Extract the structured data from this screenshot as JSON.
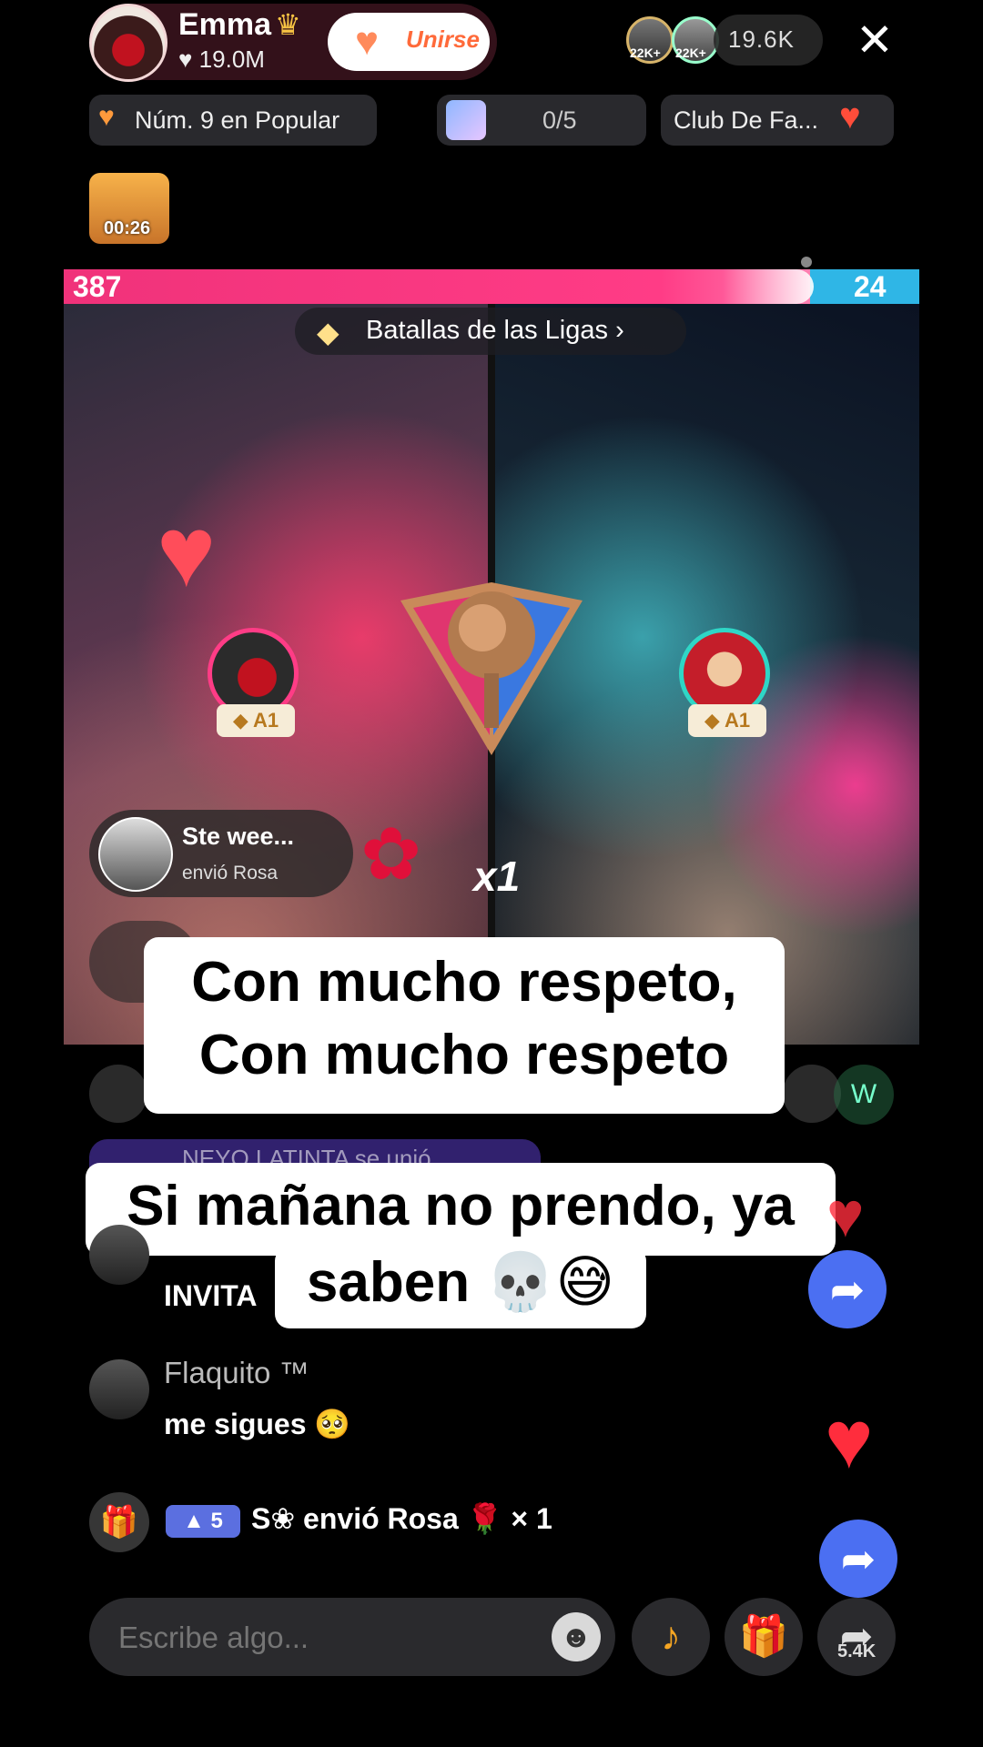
{
  "host": {
    "name": "Emma",
    "likes": "19.0M",
    "join_label": "Unirse"
  },
  "viewers": {
    "avatar_badges": [
      "22K+",
      "22K+"
    ],
    "count": "19.6K"
  },
  "chips": {
    "ranking": "Núm. 9 en Popular",
    "goal_progress": "0/5",
    "fan_club": "Club De Fa..."
  },
  "treasure": {
    "timer": "00:26"
  },
  "battle": {
    "score_left": "387",
    "score_right": "24",
    "league_label": "Batallas de las Ligas",
    "left_rank": "A1",
    "right_rank": "A1",
    "multiplier": "x1"
  },
  "gift_popup": {
    "sender": "Ste wee...",
    "action": "envió Rosa"
  },
  "captions": {
    "line1": "Con mucho respeto,",
    "line2": "Con mucho respeto",
    "line3": "Si mañana no prendo, ya",
    "line4": "saben 💀😅"
  },
  "faded_row": {
    "join_notice": "NEYO LATINTA se unió",
    "right_badge": "W"
  },
  "chat": [
    {
      "name": "",
      "message": "INVITA"
    },
    {
      "name": "Flaquito ™",
      "message": "me sigues 🥺"
    }
  ],
  "gift_line": {
    "level": "5",
    "text": "S❀ envió Rosa 🌹 × 1"
  },
  "input": {
    "placeholder": "Escribe algo..."
  },
  "share": {
    "count": "5.4K"
  }
}
